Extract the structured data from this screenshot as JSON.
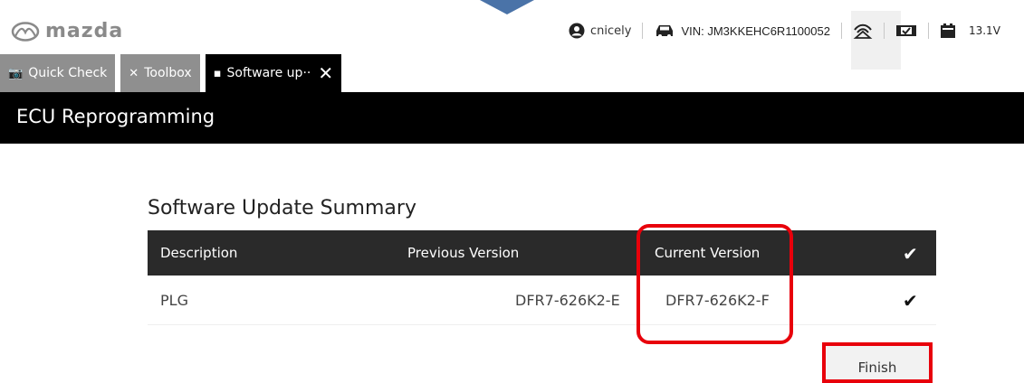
{
  "header": {
    "brand": "mazda",
    "user": "cnicely",
    "vin": "VIN: JM3KKEHC6R1100052",
    "voltage": "13.1V"
  },
  "tabs": [
    {
      "label": "Quick Check",
      "icon": "camera-icon"
    },
    {
      "label": "Toolbox",
      "icon": "tools-icon"
    },
    {
      "label": "Software up··",
      "icon": "chip-icon"
    }
  ],
  "page": {
    "title": "ECU Reprogramming"
  },
  "summary": {
    "heading": "Software Update Summary",
    "columns": [
      "Description",
      "Previous Version",
      "Current Version",
      "✔"
    ],
    "rows": [
      {
        "description": "PLG",
        "previous": "DFR7-626K2-E",
        "current": "DFR7-626K2-F",
        "status": "✔"
      }
    ]
  },
  "actions": {
    "finish": "Finish"
  },
  "colors": {
    "highlight": "#e8000b",
    "header_dark": "#2a2a2a",
    "arrow": "#4a73a8"
  }
}
